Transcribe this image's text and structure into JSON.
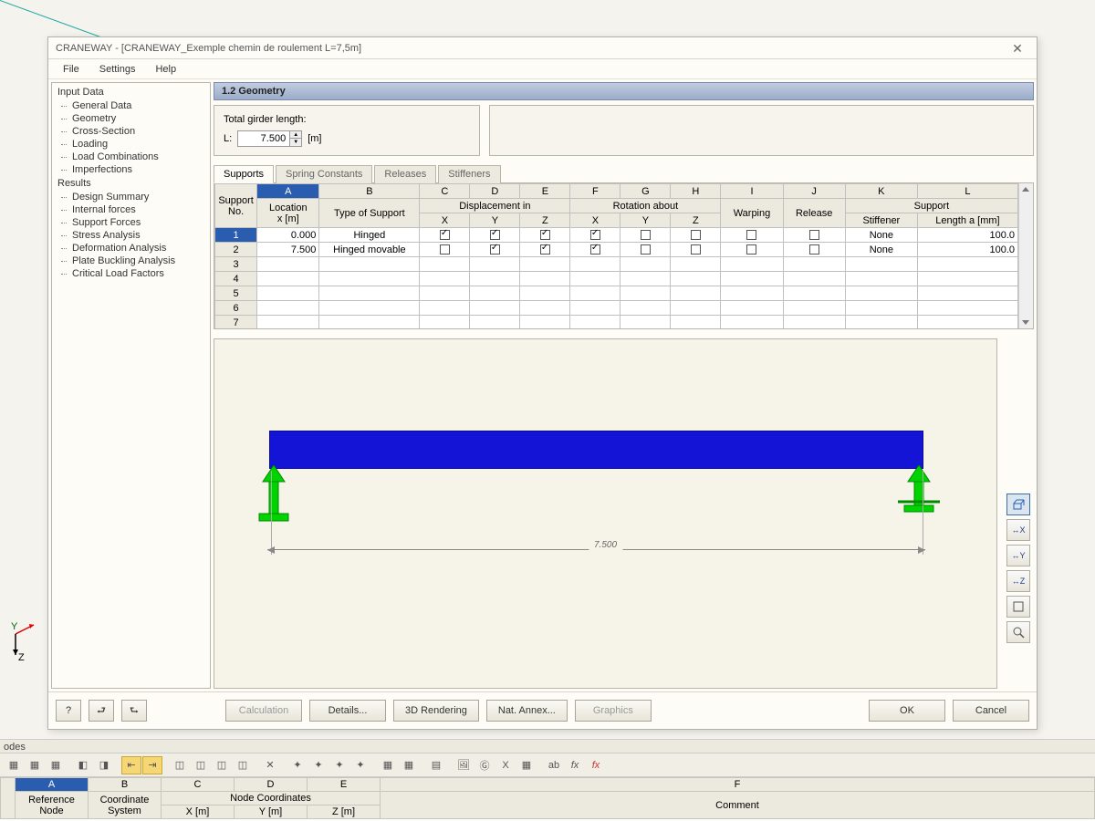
{
  "window": {
    "title": "CRANEWAY - [CRANEWAY_Exemple chemin de roulement L=7,5m]"
  },
  "menu": {
    "file": "File",
    "settings": "Settings",
    "help": "Help"
  },
  "tree": {
    "input_header": "Input Data",
    "input_items": [
      "General Data",
      "Geometry",
      "Cross-Section",
      "Loading",
      "Load Combinations",
      "Imperfections"
    ],
    "results_header": "Results",
    "results_items": [
      "Design Summary",
      "Internal forces",
      "Support Forces",
      "Stress Analysis",
      "Deformation Analysis",
      "Plate Buckling Analysis",
      "Critical Load Factors"
    ]
  },
  "section_title": "1.2 Geometry",
  "girder": {
    "label": "Total girder length:",
    "prefix": "L:",
    "value": "7.500",
    "unit": "[m]"
  },
  "tabs": {
    "supports": "Supports",
    "spring": "Spring Constants",
    "releases": "Releases",
    "stiffeners": "Stiffeners"
  },
  "grid": {
    "letters": [
      "A",
      "B",
      "C",
      "D",
      "E",
      "F",
      "G",
      "H",
      "I",
      "J",
      "K",
      "L"
    ],
    "group_support_no": "Support\nNo.",
    "group_location": "Location\nx [m]",
    "group_type": "Type of Support",
    "group_disp": "Displacement in",
    "group_rot": "Rotation about",
    "group_support": "Support",
    "sub_x": "X",
    "sub_y": "Y",
    "sub_z": "Z",
    "sub_warping": "Warping",
    "sub_release": "Release",
    "sub_stiffener": "Stiffener",
    "sub_length": "Length a [mm]",
    "rows": [
      {
        "no": "1",
        "loc": "0.000",
        "type": "Hinged",
        "dx": true,
        "dy": true,
        "dz": true,
        "rx": true,
        "ry": false,
        "rz": false,
        "warp": false,
        "rel": false,
        "stiff": "None",
        "len": "100.0"
      },
      {
        "no": "2",
        "loc": "7.500",
        "type": "Hinged movable",
        "dx": false,
        "dy": true,
        "dz": true,
        "rx": true,
        "ry": false,
        "rz": false,
        "warp": false,
        "rel": false,
        "stiff": "None",
        "len": "100.0"
      }
    ],
    "empty_rows": [
      "3",
      "4",
      "5",
      "6",
      "7"
    ]
  },
  "viz": {
    "dim": "7.500",
    "buttons": [
      "iso",
      "X",
      "Y",
      "Z",
      "fit",
      "find"
    ]
  },
  "buttons": {
    "help": "?",
    "prev": "◄",
    "next": "►",
    "calculation": "Calculation",
    "details": "Details...",
    "render": "3D Rendering",
    "annex": "Nat. Annex...",
    "graphics": "Graphics",
    "ok": "OK",
    "cancel": "Cancel"
  },
  "host": {
    "bar_label": "odes",
    "col_letters": [
      "A",
      "B",
      "C",
      "D",
      "E",
      "F"
    ],
    "col_groups": {
      "ref": "Reference\nNode",
      "coord": "Coordinate\nSystem",
      "nodes": "Node Coordinates",
      "comment": "Comment"
    },
    "col_sub": {
      "x": "X [m]",
      "y": "Y [m]",
      "z": "Z [m]"
    }
  }
}
